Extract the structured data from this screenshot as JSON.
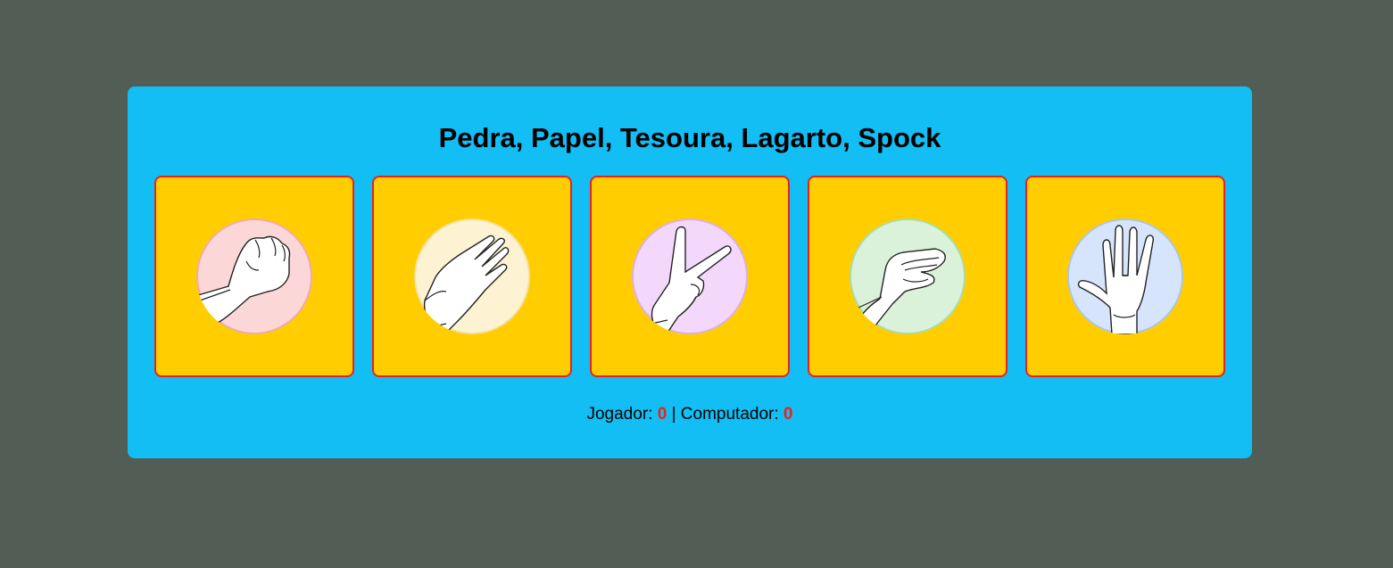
{
  "title": "Pedra, Papel, Tesoura, Lagarto, Spock",
  "choices": [
    {
      "icon": "rock-hand-icon",
      "bg": "#fbd7d8",
      "ring": "#f1a9ad"
    },
    {
      "icon": "paper-hand-icon",
      "bg": "#fdf2d2",
      "ring": "#f3e0a2"
    },
    {
      "icon": "scissors-hand-icon",
      "bg": "#f3d8fb",
      "ring": "#dcaef0"
    },
    {
      "icon": "lizard-hand-icon",
      "bg": "#d9f2d9",
      "ring": "#a9dcae"
    },
    {
      "icon": "spock-hand-icon",
      "bg": "#d6e5fb",
      "ring": "#a9c5ef"
    }
  ],
  "score": {
    "player_label": "Jogador:",
    "player_value": "0",
    "separator": "|",
    "computer_label": "Computador:",
    "computer_value": "0"
  },
  "colors": {
    "page_bg": "#525e55",
    "panel_bg": "#12bef3",
    "card_bg": "#ffcd00",
    "card_border": "#e8231d",
    "score_number": "#e8231d"
  }
}
